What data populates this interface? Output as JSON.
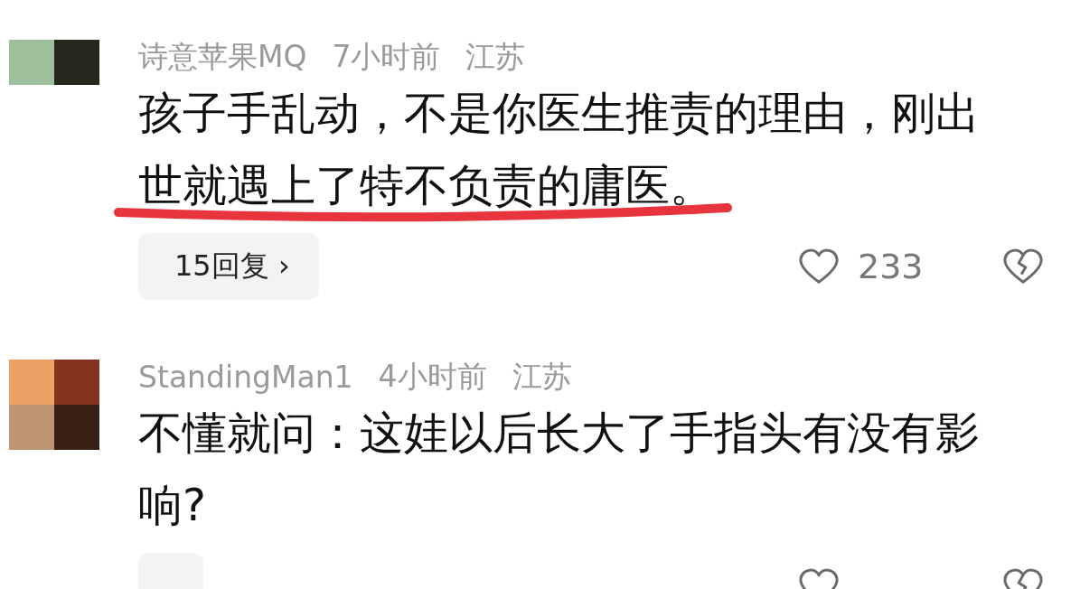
{
  "comments": [
    {
      "user": "诗意苹果MQ",
      "time": "7小时前",
      "location": "江苏",
      "lines": [
        {
          "text": "孩子手乱动，不是你医生推责的理由，刚出",
          "underlined": false
        },
        {
          "text": "世就遇上了特不负责的庸医。",
          "underlined": true
        }
      ],
      "replies": "15回复 ›",
      "likes": "233"
    },
    {
      "user": "StandingMan1",
      "time": "4小时前",
      "location": "江苏",
      "lines": [
        {
          "text": "不懂就问：这娃以后长大了手指头有没有影",
          "underlined": false
        },
        {
          "text": "响?",
          "underlined": false
        }
      ]
    }
  ]
}
